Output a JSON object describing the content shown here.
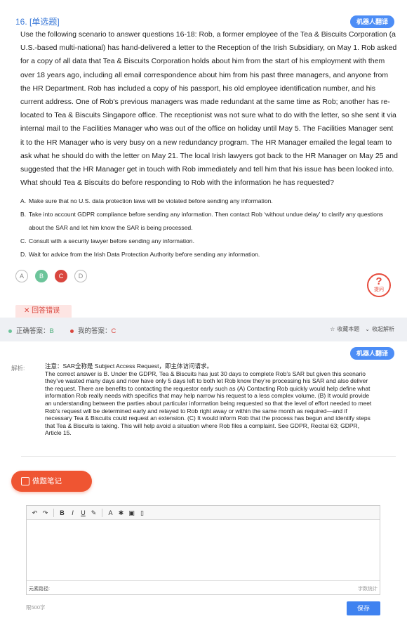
{
  "question": {
    "number_label": "16. [单选题]",
    "translate_label": "机器人翻译",
    "stem": "Use the following scenario to answer questions 16-18: Rob, a former employee of the Tea & Biscuits Corporation (a U.S.-based multi-national) has hand-delivered a letter to the Reception of the Irish Subsidiary, on May 1. Rob asked for a copy of all data that Tea & Biscuits Corporation holds about him from the start of his employment with them over 18 years ago, including all email correspondence about him from his past three managers, and anyone from the HR Department. Rob has included a copy of his passport, his old employee identification number, and his current address. One of Rob's previous managers was made redundant at the same time as Rob; another has re-located to Tea & Biscuits Singapore office. The receptionist was not sure what to do with the letter, so she sent it via internal mail to the Facilities Manager who was out of the office on holiday until May 5. The Facilities Manager sent it to the HR Manager who is very busy on a new redundancy program. The HR Manager emailed the legal team to ask what he should do with the letter on May 21. The local Irish lawyers got back to the HR Manager on May 25 and suggested that the HR Manager get in touch with Rob immediately and tell him that his issue has been looked into. What should Tea & Biscuits do before responding to Rob with the information he has requested?",
    "options": [
      {
        "key": "A.",
        "text": "Make sure that no U.S. data protection laws will be violated before sending any information."
      },
      {
        "key": "B.",
        "text": "Take into account GDPR compliance before sending any information. Then contact Rob ‘without undue delay’ to clarify any questions about the SAR and let him know the SAR is being processed."
      },
      {
        "key": "C.",
        "text": "Consult with a security lawyer before sending any information."
      },
      {
        "key": "D.",
        "text": "Wait for advice from the Irish Data Protection Authority before sending any information."
      }
    ],
    "choices": [
      "A",
      "B",
      "C",
      "D"
    ],
    "ask_label": "提问",
    "wrong_label": "回答错误"
  },
  "answer_bar": {
    "correct_label": "正确答案：",
    "correct_value": "B",
    "mine_label": "我的答案：",
    "mine_value": "C",
    "favorite_label": "收藏本题",
    "collapse_label": "收起解析"
  },
  "analysis": {
    "translate_label": "机器人翻译",
    "label": "解析:",
    "text": "注意：SAR全称是 Subject Access Request，即主体访问请求。\nThe correct answer is B. Under the GDPR, Tea & Biscuits has just 30 days to complete Rob’s SAR but given this scenario they’ve wasted many days and now have only 5 days left to both let Rob know they’re processing his SAR and also deliver the request. There are benefits to contacting the requestor early such as (A) Contacting Rob quickly would help define what information Rob really needs with specifics that may help narrow his request to a less complex volume. (B) It would provide an understanding between the parties about particular information being requested so that the level of effort needed to meet Rob’s request will be determined early and relayed to Rob right away or within the same month as required—and if necessary Tea & Biscuits could request an extension. (C) It would inform Rob that the process has begun and identify steps that Tea & Biscuits is taking. This will help avoid a situation where Rob files a complaint. See GDPR, Recital 63; GDPR, Article 15."
  },
  "notes": {
    "button_label": "做题笔记",
    "path_label": "元素路径:",
    "count_label": "字数统计",
    "limit_label": "限500字",
    "save_label": "保存"
  },
  "colors": {
    "accent": "#4c8df6",
    "correct": "#6cc49a",
    "wrong": "#d9463e",
    "note_button": "#ef5532"
  }
}
